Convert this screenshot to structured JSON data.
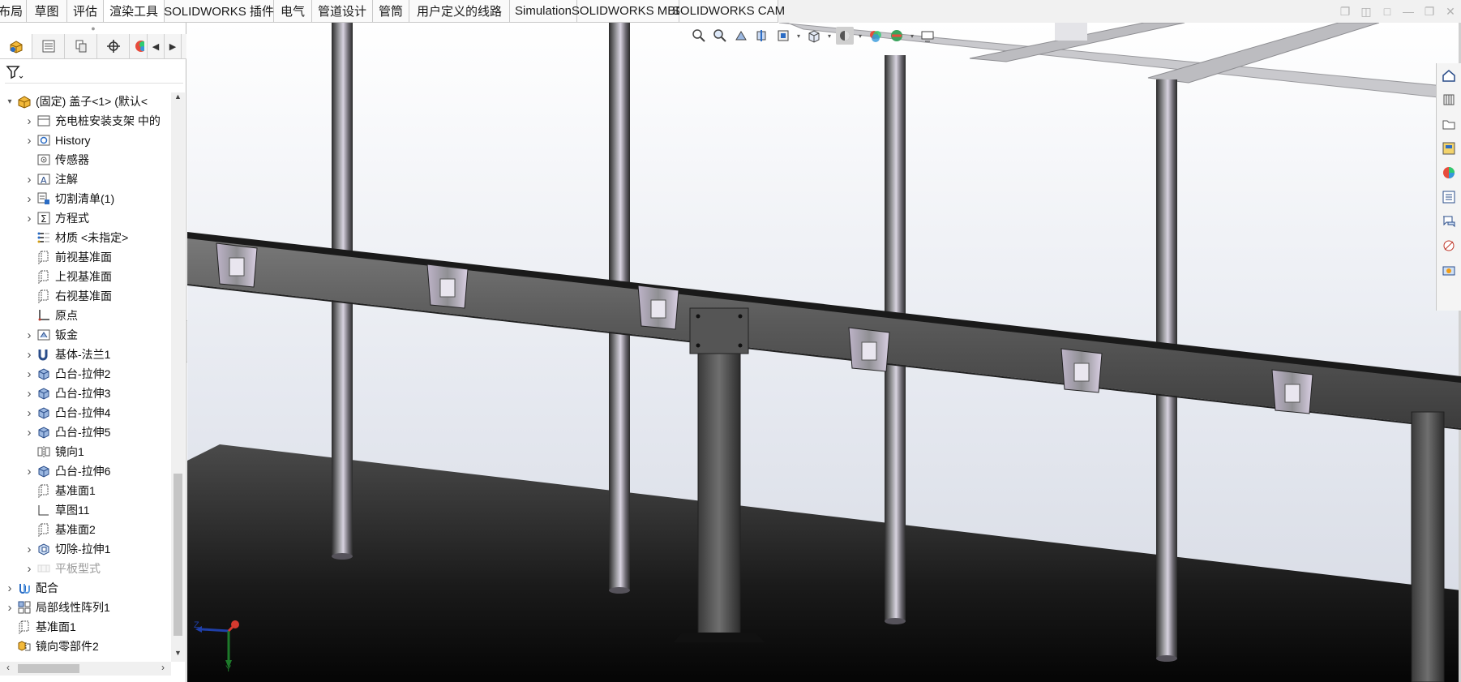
{
  "command_tabs": [
    "布局",
    "草图",
    "评估",
    "渲染工具",
    "SOLIDWORKS 插件",
    "电气",
    "管道设计",
    "管筒",
    "用户定义的线路",
    "Simulation",
    "SOLIDWORKS MBD",
    "SOLIDWORKS CAM"
  ],
  "active_tab": "渲染工具",
  "feature_tree": {
    "root_label": "(固定) 盖子<1> (默认<",
    "items": [
      {
        "label": "充电桩安装支架 中的",
        "icon": "part-folder-icon",
        "expandable": true
      },
      {
        "label": "History",
        "icon": "history-icon",
        "expandable": true
      },
      {
        "label": "传感器",
        "icon": "sensor-icon",
        "expandable": false
      },
      {
        "label": "注解",
        "icon": "annotation-icon",
        "expandable": true
      },
      {
        "label": "切割清单(1)",
        "icon": "cut-list-icon",
        "expandable": true
      },
      {
        "label": "方程式",
        "icon": "equation-icon",
        "expandable": true
      },
      {
        "label": "材质 <未指定>",
        "icon": "material-icon",
        "expandable": false
      },
      {
        "label": "前视基准面",
        "icon": "plane-icon",
        "expandable": false
      },
      {
        "label": "上视基准面",
        "icon": "plane-icon",
        "expandable": false
      },
      {
        "label": "右视基准面",
        "icon": "plane-icon",
        "expandable": false
      },
      {
        "label": "原点",
        "icon": "origin-icon",
        "expandable": false
      },
      {
        "label": "钣金",
        "icon": "sheet-metal-icon",
        "expandable": true
      },
      {
        "label": "基体-法兰1",
        "icon": "base-flange-icon",
        "expandable": true
      },
      {
        "label": "凸台-拉伸2",
        "icon": "boss-extrude-icon",
        "expandable": true
      },
      {
        "label": "凸台-拉伸3",
        "icon": "boss-extrude-icon",
        "expandable": true
      },
      {
        "label": "凸台-拉伸4",
        "icon": "boss-extrude-icon",
        "expandable": true
      },
      {
        "label": "凸台-拉伸5",
        "icon": "boss-extrude-icon",
        "expandable": true
      },
      {
        "label": "镜向1",
        "icon": "mirror-icon",
        "expandable": false
      },
      {
        "label": "凸台-拉伸6",
        "icon": "boss-extrude-icon",
        "expandable": true
      },
      {
        "label": "基准面1",
        "icon": "plane-icon",
        "expandable": false
      },
      {
        "label": "草图11",
        "icon": "sketch-icon",
        "expandable": false
      },
      {
        "label": "基准面2",
        "icon": "plane-icon",
        "expandable": false
      },
      {
        "label": "切除-拉伸1",
        "icon": "cut-extrude-icon",
        "expandable": true
      },
      {
        "label": "平板型式",
        "icon": "flat-pattern-icon",
        "expandable": true,
        "disabled": true
      }
    ],
    "assembly_items": [
      {
        "label": "配合",
        "icon": "mates-icon",
        "expandable": true
      },
      {
        "label": "局部线性阵列1",
        "icon": "linear-pattern-icon",
        "expandable": true
      },
      {
        "label": "基准面1",
        "icon": "plane-icon",
        "expandable": false
      },
      {
        "label": "镜向零部件2",
        "icon": "mirror-component-icon",
        "expandable": false
      }
    ]
  },
  "triad": {
    "x_axis": "Z",
    "y_axis": "Y"
  },
  "colors": {
    "accent": "#2b6cc4",
    "tab_bg": "#fafafa",
    "panel_border": "#bdbdbd"
  }
}
